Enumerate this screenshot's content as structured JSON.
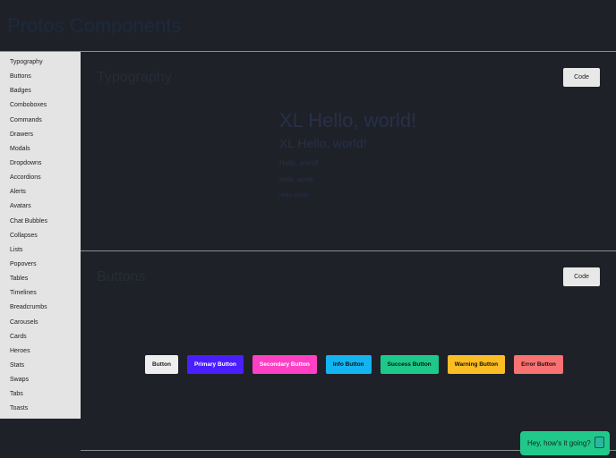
{
  "header": {
    "title": "Protos Components"
  },
  "sidebar": {
    "items": [
      "Typography",
      "Buttons",
      "Badges",
      "Comboboxes",
      "Commands",
      "Drawers",
      "Modals",
      "Dropdowns",
      "Accordions",
      "Alerts",
      "Avatars",
      "Chat Bubbles",
      "Collapses",
      "Lists",
      "Popovers",
      "Tables",
      "Timelines",
      "Breadcrumbs",
      "Carousels",
      "Cards",
      "Heroes",
      "Stats",
      "Swaps",
      "Tabs",
      "Toasts"
    ]
  },
  "typography": {
    "title": "Typography",
    "code": "Code",
    "lines": [
      "XL Hello, world!",
      "XL Hello, world!",
      "Hello, world!",
      "Hello, world!",
      "Hello, world!"
    ]
  },
  "buttons": {
    "title": "Buttons",
    "code": "Code",
    "items": [
      "Button",
      "Primary Button",
      "Secondary Button",
      "Info Button",
      "Success Button",
      "Warning Button",
      "Error Button"
    ]
  },
  "toast": {
    "text": "Hey, how's it going?"
  },
  "colors": {
    "primary": "#4a1fff",
    "secondary": "#ff3fc4",
    "info": "#14b4f0",
    "success": "#1dc98a",
    "warning": "#fbbd23",
    "error": "#f87272"
  }
}
